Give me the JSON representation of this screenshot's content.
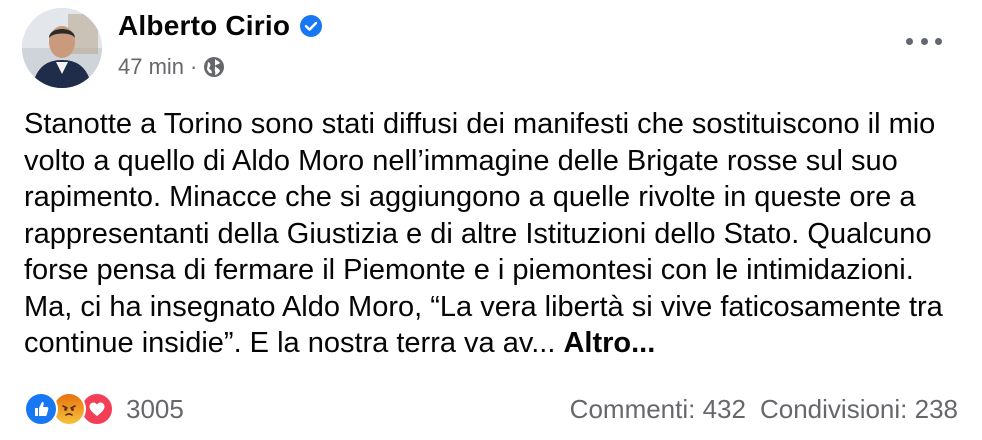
{
  "post": {
    "author": "Alberto Cirio",
    "timestamp": "47 min",
    "separator": "·",
    "privacy_icon": "globe-icon",
    "verified_icon": "verified-badge-icon",
    "text": "Stanotte a Torino sono stati diffusi dei manifesti che sostituiscono il mio volto a quello di Aldo Moro nell’immagine delle Brigate rosse sul suo rapimento. Minacce che si aggiungono a quelle rivolte in queste ore a rappresentanti della Giustizia e di altre Istituzioni dello Stato. Qualcuno forse pensa di fermare il Piemonte e i piemontesi con le intimidazioni. Ma, ci ha insegnato Aldo Moro, “La vera libertà si vive faticosamente tra continue insidie”. E la nostra terra va av...",
    "see_more": "Altro..."
  },
  "footer": {
    "reaction_icons": [
      "like-icon",
      "angry-icon",
      "love-icon"
    ],
    "reaction_count": "3005",
    "comments": "Commenti: 432",
    "shares": "Condivisioni: 238"
  },
  "colors": {
    "accent": "#1877f2",
    "secondary_text": "#65676b",
    "love": "#f33e58",
    "angry": "#e9710f"
  }
}
